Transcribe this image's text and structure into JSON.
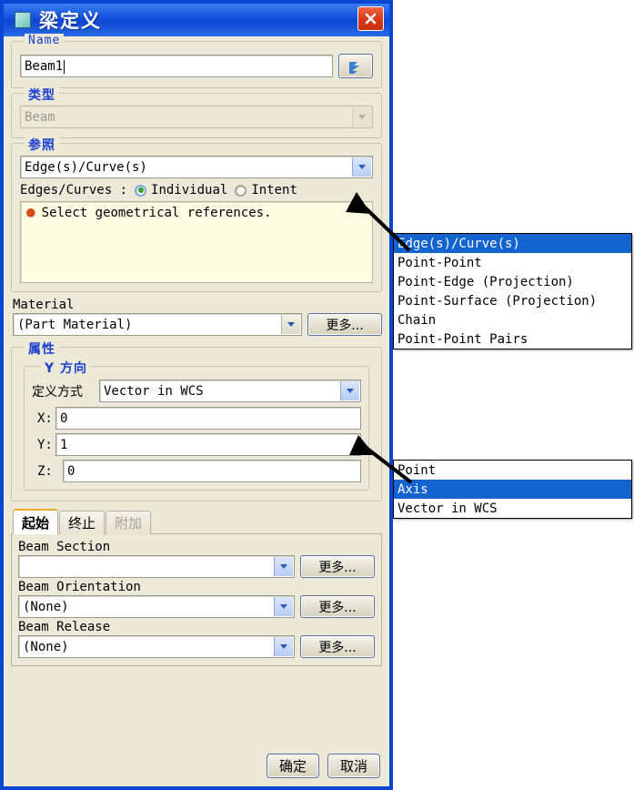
{
  "window": {
    "title": "梁定义",
    "icon": "beam-icon",
    "close_label": "×"
  },
  "name_group": {
    "legend": "Name",
    "value": "Beam1",
    "regen_icon": "regenerate-icon"
  },
  "type_group": {
    "legend": "类型",
    "value": "Beam"
  },
  "reference_group": {
    "legend": "参照",
    "combo_value": "Edge(s)/Curve(s)",
    "edges_label": "Edges/Curves :",
    "radio_individual": "Individual",
    "radio_intent": "Intent",
    "selected_radio": "Individual",
    "status_message": "Select geometrical references."
  },
  "material": {
    "label": "Material",
    "value": "(Part Material)",
    "more_label": "更多..."
  },
  "properties": {
    "legend": "属性",
    "y_direction": {
      "legend": "Y 方向",
      "define_label": "定义方式",
      "define_value": "Vector in WCS",
      "x_label": "X:",
      "x_value": "0",
      "y_label": "Y:",
      "y_value": "1",
      "z_label": "Z:",
      "z_value": "0"
    }
  },
  "tabs": [
    {
      "label": "起始",
      "active": true,
      "disabled": false
    },
    {
      "label": "终止",
      "active": false,
      "disabled": false
    },
    {
      "label": "附加",
      "active": false,
      "disabled": true
    }
  ],
  "tab_panel": {
    "beam_section": {
      "label": "Beam Section",
      "value": "",
      "more_label": "更多..."
    },
    "beam_orientation": {
      "label": "Beam Orientation",
      "value": "(None)",
      "more_label": "更多..."
    },
    "beam_release": {
      "label": "Beam Release",
      "value": "(None)",
      "more_label": "更多..."
    }
  },
  "footer": {
    "ok_label": "确定",
    "cancel_label": "取消"
  },
  "popup_reference": {
    "options": [
      "Edge(s)/Curve(s)",
      "Point-Point",
      "Point-Edge (Projection)",
      "Point-Surface (Projection)",
      "Chain",
      "Point-Point Pairs"
    ],
    "selected": "Edge(s)/Curve(s)"
  },
  "popup_direction": {
    "options": [
      "Point",
      "Axis",
      "Vector in WCS"
    ],
    "selected": "Axis"
  },
  "colors": {
    "title_blue": "#0f46cf",
    "dialog_bg": "#ece9d8",
    "legend_blue": "#1b3fd0",
    "select_blue": "#1364cf",
    "close_red": "#d8391a",
    "bullet_orange": "#d84a16",
    "tab_accent": "#f0a830"
  }
}
